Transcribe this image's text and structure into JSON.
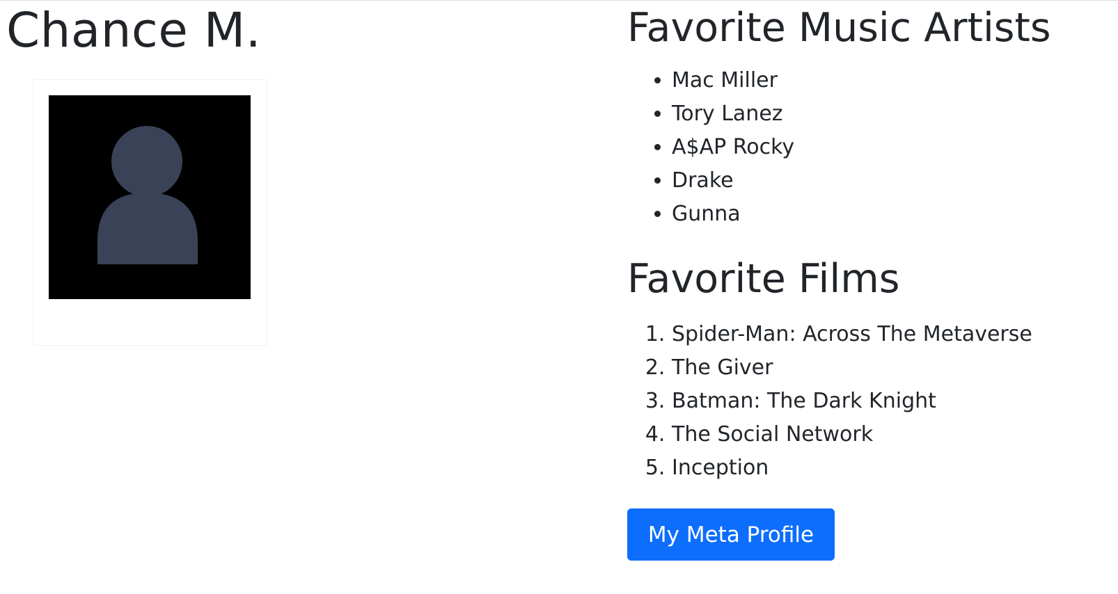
{
  "profile": {
    "name": "Chance M."
  },
  "artists": {
    "heading": "Favorite Music Artists",
    "items": [
      "Mac Miller",
      "Tory Lanez",
      "A$AP Rocky",
      "Drake",
      "Gunna"
    ]
  },
  "films": {
    "heading": "Favorite Films",
    "items": [
      "Spider-Man: Across The Metaverse",
      "The Giver",
      "Batman: The Dark Knight",
      "The Social Network",
      "Inception"
    ]
  },
  "actions": {
    "meta_profile_label": "My Meta Profile"
  },
  "colors": {
    "button_bg": "#0d6efd",
    "avatar_bg": "#000000",
    "avatar_figure": "#3a4257"
  },
  "icons": {
    "avatar": "default-user-silhouette-icon"
  }
}
